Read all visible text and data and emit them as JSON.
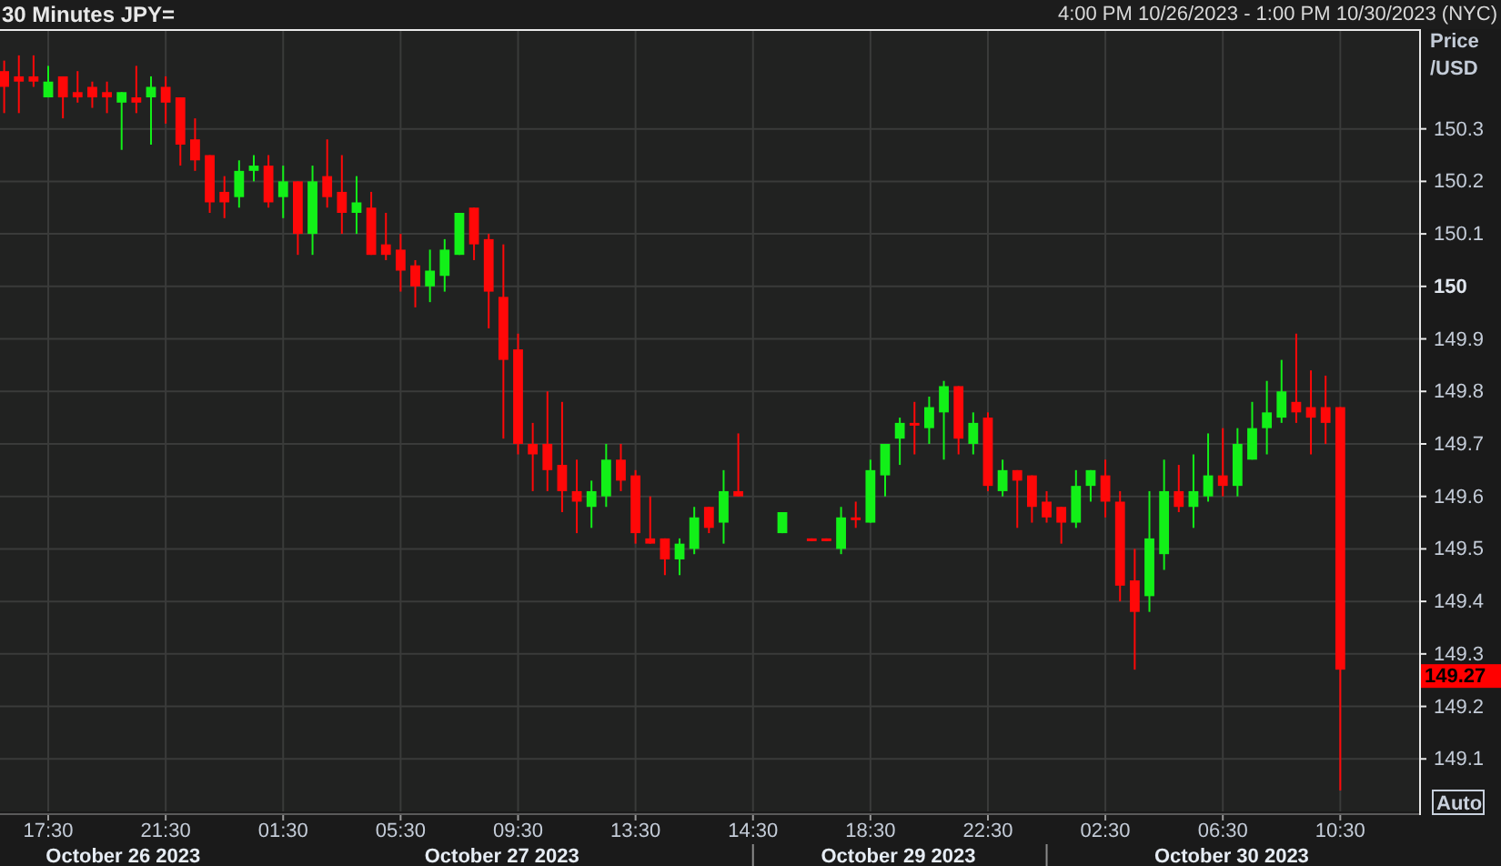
{
  "header": {
    "title": "30 Minutes JPY=",
    "range": "4:00 PM 10/26/2023 - 1:00 PM 10/30/2023 (NYC)"
  },
  "chart": {
    "chart_data": {
      "type": "candlestick",
      "ylabel": "Price /USD",
      "ylim": [
        149.0,
        150.49
      ],
      "yticks": [
        {
          "value": 150.3,
          "label": "150.3"
        },
        {
          "value": 150.2,
          "label": "150.2"
        },
        {
          "value": 150.1,
          "label": "150.1"
        },
        {
          "value": 150,
          "label": "150"
        },
        {
          "value": 149.9,
          "label": "149.9"
        },
        {
          "value": 149.8,
          "label": "149.8"
        },
        {
          "value": 149.7,
          "label": "149.7"
        },
        {
          "value": 149.6,
          "label": "149.6"
        },
        {
          "value": 149.5,
          "label": "149.5"
        },
        {
          "value": 149.4,
          "label": "149.4"
        },
        {
          "value": 149.3,
          "label": "149.3"
        },
        {
          "value": 149.2,
          "label": "149.2"
        },
        {
          "value": 149.1,
          "label": "149.1"
        }
      ],
      "grid": true,
      "categories": [
        null,
        null,
        null,
        "17:30",
        null,
        null,
        null,
        null,
        null,
        null,
        null,
        "21:30",
        null,
        null,
        null,
        null,
        null,
        null,
        null,
        "01:30",
        null,
        null,
        null,
        null,
        null,
        null,
        null,
        "05:30",
        null,
        null,
        null,
        null,
        null,
        null,
        null,
        "09:30",
        null,
        null,
        null,
        null,
        null,
        null,
        null,
        "13:30",
        null,
        null,
        null,
        null,
        null,
        null,
        null,
        "14:30",
        null,
        null,
        null,
        null,
        null,
        null,
        null,
        "18:30",
        null,
        null,
        null,
        null,
        null,
        null,
        null,
        "22:30",
        null,
        null,
        null,
        null,
        null,
        null,
        null,
        "02:30",
        null,
        null,
        null,
        null,
        null,
        null,
        null,
        "06:30",
        null,
        null,
        null,
        null,
        null,
        null,
        null,
        "10:30"
      ],
      "ohlc": [
        [
          150.41,
          150.43,
          150.33,
          150.38
        ],
        [
          150.4,
          150.44,
          150.33,
          150.39
        ],
        [
          150.4,
          150.44,
          150.38,
          150.39
        ],
        [
          150.36,
          150.42,
          150.36,
          150.39
        ],
        [
          150.4,
          150.4,
          150.32,
          150.36
        ],
        [
          150.37,
          150.41,
          150.35,
          150.36
        ],
        [
          150.38,
          150.39,
          150.34,
          150.36
        ],
        [
          150.37,
          150.39,
          150.33,
          150.36
        ],
        [
          150.35,
          150.37,
          150.26,
          150.37
        ],
        [
          150.36,
          150.42,
          150.33,
          150.35
        ],
        [
          150.36,
          150.4,
          150.27,
          150.38
        ],
        [
          150.38,
          150.4,
          150.31,
          150.35
        ],
        [
          150.36,
          150.36,
          150.23,
          150.27
        ],
        [
          150.28,
          150.32,
          150.22,
          150.24
        ],
        [
          150.25,
          150.25,
          150.14,
          150.16
        ],
        [
          150.18,
          150.21,
          150.13,
          150.16
        ],
        [
          150.17,
          150.24,
          150.15,
          150.22
        ],
        [
          150.22,
          150.25,
          150.2,
          150.23
        ],
        [
          150.23,
          150.25,
          150.15,
          150.16
        ],
        [
          150.17,
          150.23,
          150.13,
          150.2
        ],
        [
          150.2,
          150.2,
          150.06,
          150.1
        ],
        [
          150.1,
          150.23,
          150.06,
          150.2
        ],
        [
          150.21,
          150.28,
          150.15,
          150.17
        ],
        [
          150.18,
          150.25,
          150.1,
          150.14
        ],
        [
          150.14,
          150.21,
          150.1,
          150.16
        ],
        [
          150.15,
          150.18,
          150.06,
          150.06
        ],
        [
          150.08,
          150.14,
          150.05,
          150.06
        ],
        [
          150.07,
          150.1,
          149.99,
          150.03
        ],
        [
          150.04,
          150.05,
          149.96,
          150.0
        ],
        [
          150.0,
          150.07,
          149.97,
          150.03
        ],
        [
          150.02,
          150.09,
          149.99,
          150.07
        ],
        [
          150.06,
          150.14,
          150.06,
          150.14
        ],
        [
          150.15,
          150.15,
          150.05,
          150.08
        ],
        [
          150.09,
          150.1,
          149.92,
          149.99
        ],
        [
          149.98,
          150.08,
          149.71,
          149.86
        ],
        [
          149.88,
          149.91,
          149.68,
          149.7
        ],
        [
          149.7,
          149.74,
          149.61,
          149.68
        ],
        [
          149.7,
          149.8,
          149.61,
          149.65
        ],
        [
          149.66,
          149.78,
          149.57,
          149.61
        ],
        [
          149.61,
          149.67,
          149.53,
          149.59
        ],
        [
          149.58,
          149.63,
          149.54,
          149.61
        ],
        [
          149.6,
          149.7,
          149.58,
          149.67
        ],
        [
          149.67,
          149.7,
          149.61,
          149.63
        ],
        [
          149.64,
          149.65,
          149.51,
          149.53
        ],
        [
          149.52,
          149.6,
          149.51,
          149.51
        ],
        [
          149.52,
          149.52,
          149.45,
          149.48
        ],
        [
          149.48,
          149.52,
          149.45,
          149.51
        ],
        [
          149.5,
          149.58,
          149.49,
          149.56
        ],
        [
          149.58,
          149.58,
          149.53,
          149.54
        ],
        [
          149.55,
          149.65,
          149.51,
          149.61
        ],
        [
          149.61,
          149.72,
          149.6,
          149.6
        ],
        null,
        null,
        [
          149.53,
          149.57,
          149.53,
          149.57
        ],
        null,
        [
          149.52,
          149.52,
          149.52,
          149.52
        ],
        [
          149.52,
          149.52,
          149.52,
          149.52
        ],
        [
          149.5,
          149.58,
          149.49,
          149.56
        ],
        [
          149.56,
          149.59,
          149.54,
          149.56
        ],
        [
          149.55,
          149.67,
          149.55,
          149.65
        ],
        [
          149.64,
          149.7,
          149.6,
          149.7
        ],
        [
          149.71,
          149.75,
          149.66,
          149.74
        ],
        [
          149.74,
          149.78,
          149.68,
          149.74
        ],
        [
          149.73,
          149.79,
          149.7,
          149.77
        ],
        [
          149.76,
          149.82,
          149.67,
          149.81
        ],
        [
          149.81,
          149.81,
          149.68,
          149.71
        ],
        [
          149.7,
          149.76,
          149.68,
          149.74
        ],
        [
          149.75,
          149.76,
          149.61,
          149.62
        ],
        [
          149.61,
          149.67,
          149.6,
          149.65
        ],
        [
          149.65,
          149.65,
          149.54,
          149.63
        ],
        [
          149.64,
          149.64,
          149.55,
          149.58
        ],
        [
          149.59,
          149.61,
          149.55,
          149.56
        ],
        [
          149.58,
          149.58,
          149.51,
          149.55
        ],
        [
          149.55,
          149.65,
          149.54,
          149.62
        ],
        [
          149.62,
          149.65,
          149.59,
          149.65
        ],
        [
          149.64,
          149.67,
          149.56,
          149.59
        ],
        [
          149.59,
          149.61,
          149.4,
          149.43
        ],
        [
          149.44,
          149.5,
          149.27,
          149.38
        ],
        [
          149.41,
          149.61,
          149.38,
          149.52
        ],
        [
          149.49,
          149.67,
          149.46,
          149.61
        ],
        [
          149.61,
          149.66,
          149.57,
          149.58
        ],
        [
          149.58,
          149.68,
          149.54,
          149.61
        ],
        [
          149.6,
          149.72,
          149.59,
          149.64
        ],
        [
          149.64,
          149.73,
          149.6,
          149.62
        ],
        [
          149.62,
          149.73,
          149.6,
          149.7
        ],
        [
          149.67,
          149.78,
          149.67,
          149.73
        ],
        [
          149.73,
          149.82,
          149.68,
          149.76
        ],
        [
          149.75,
          149.86,
          149.74,
          149.8
        ],
        [
          149.78,
          149.91,
          149.74,
          149.76
        ],
        [
          149.77,
          149.84,
          149.68,
          149.75
        ],
        [
          149.77,
          149.83,
          149.7,
          149.74
        ],
        [
          149.77,
          149.77,
          149.04,
          149.27
        ]
      ]
    },
    "date_labels": [
      "October 26 2023",
      "October 27 2023",
      "October 29 2023",
      "October 30 2023"
    ],
    "last_price": "149.27",
    "auto_button": "Auto"
  }
}
